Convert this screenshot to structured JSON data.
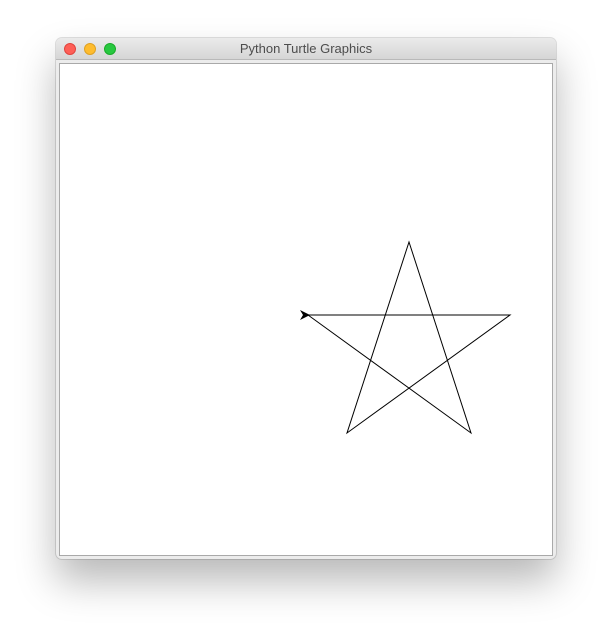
{
  "window": {
    "title": "Python Turtle Graphics",
    "controls": {
      "close": "close-button",
      "minimize": "minimize-button",
      "zoom": "zoom-button"
    }
  },
  "canvas": {
    "background": "#ffffff",
    "pen_color": "#000000",
    "drawing": "five-pointed star",
    "cursor": "turtle-arrow-icon"
  },
  "colors": {
    "close": "#fe5f57",
    "minimize": "#febc2e",
    "zoom": "#28c840"
  }
}
